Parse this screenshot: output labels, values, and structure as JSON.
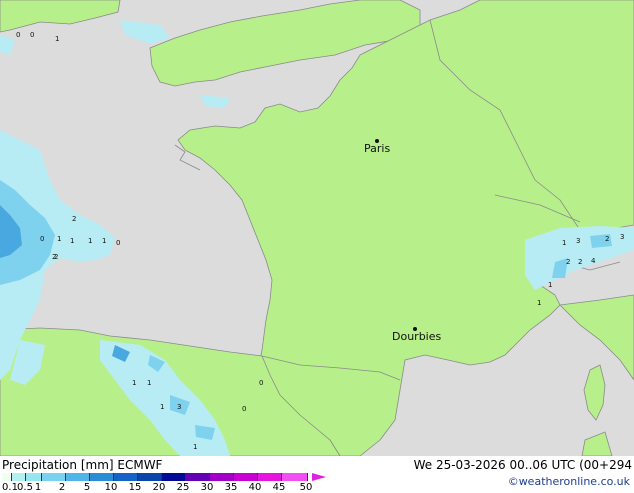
{
  "legend": {
    "title": "Precipitation [mm]  ECMWF",
    "datetime": "We 25-03-2026 00..06 UTC (00+294",
    "credit": "©weatheronline.co.uk",
    "ticks": [
      "0.1",
      "0.5",
      "1",
      "2",
      "5",
      "10",
      "15",
      "20",
      "25",
      "30",
      "35",
      "40",
      "45",
      "50"
    ],
    "colors": [
      "#f0fff0",
      "#b4f0f0",
      "#96e6f0",
      "#78d2f0",
      "#50b4e6",
      "#2a8cd2",
      "#1464c8",
      "#0a46aa",
      "#000a96",
      "#6400b4",
      "#a000c8",
      "#c800d2",
      "#e614dc",
      "#f050f0"
    ]
  },
  "cities": [
    {
      "name": "Paris"
    },
    {
      "name": "Dourbies"
    }
  ],
  "colors": {
    "land": "#b7f08a",
    "sea": "#dcdcdc",
    "border": "#8a8a8a",
    "light_precip": "#b8ecf4",
    "med_precip": "#7fd2ee",
    "heavy_precip": "#4aa8e0"
  },
  "precip_values": [
    "0",
    "0",
    "1",
    "2",
    "1",
    "0",
    "1",
    "1",
    "1",
    "0",
    "2",
    "3",
    "1",
    "2",
    "2",
    "4",
    "3",
    "2",
    "1",
    "1",
    "1",
    "1",
    "2",
    "0",
    "1",
    "3",
    "1",
    "0"
  ]
}
